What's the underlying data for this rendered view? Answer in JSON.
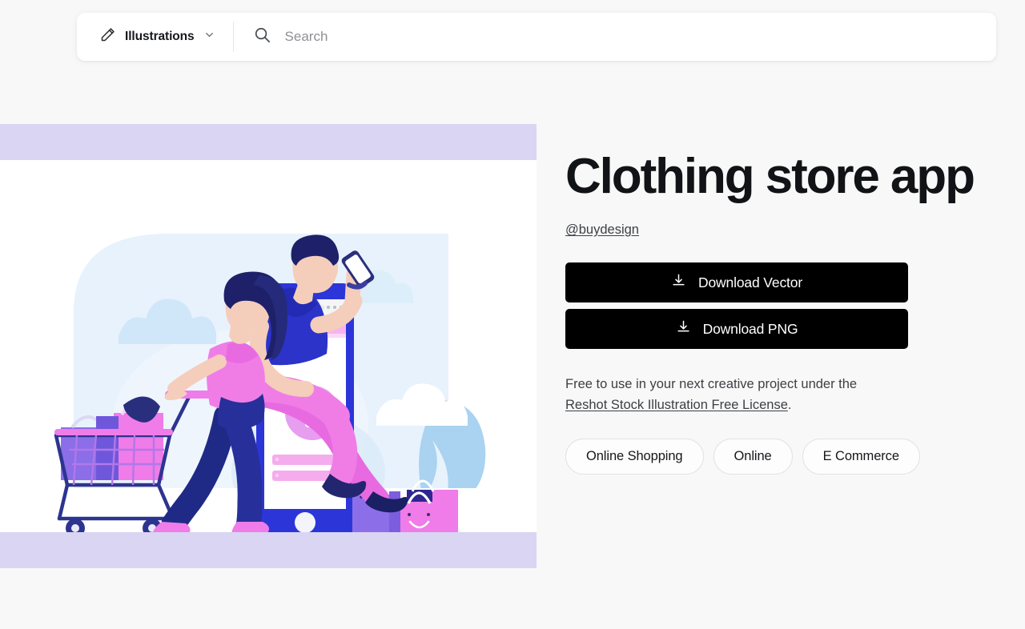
{
  "search": {
    "category_label": "Illustrations",
    "category_icon": "pencil-icon",
    "chevron_icon": "chevron-down-icon",
    "search_icon": "search-icon",
    "placeholder": "Search",
    "value": ""
  },
  "detail": {
    "title": "Clothing store app",
    "author": "@buydesign",
    "download_vector_label": "Download Vector",
    "download_png_label": "Download PNG",
    "download_icon": "download-icon",
    "license_prefix": "Free to use in your next creative project under the",
    "license_link": "Reshot Stock Illustration Free License",
    "license_suffix": ".",
    "tags": [
      "Online Shopping",
      "Online",
      "E Commerce"
    ]
  },
  "illustration": {
    "alt": "Woman pushing shopping cart and man sitting on a giant smartphone with shopping bags",
    "colors": {
      "band": "#d9d5f2",
      "backdrop_blue": "#e8f2fc",
      "cloud": "#cfe7f9",
      "leaf": "#a9d3f0",
      "phone_body": "#2c35d8",
      "phone_screen": "#ffffff",
      "accent_pink": "#f07de6",
      "light_pink": "#f7b3ef",
      "deep_navy": "#1b1f63",
      "royal_blue": "#2b33c9",
      "skin": "#f5cdbb",
      "bag_purple": "#8b6ee8",
      "bag_pink": "#f07de6",
      "cart_frame": "#2d348f"
    }
  },
  "theme": {
    "page_background": "#f8f8f8",
    "button_background": "#000000",
    "button_text": "#ffffff"
  }
}
